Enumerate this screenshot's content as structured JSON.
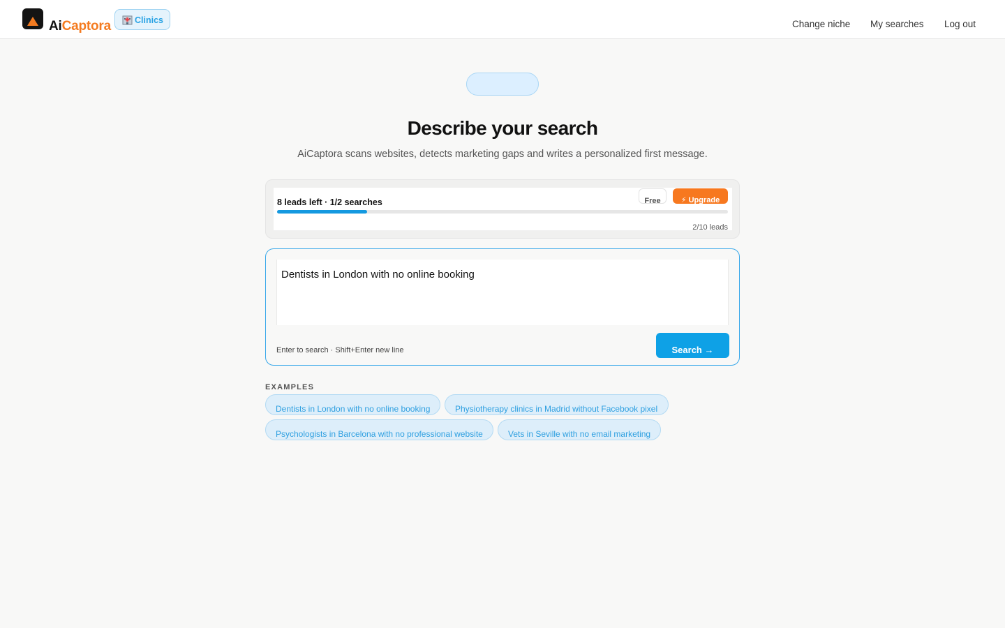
{
  "header": {
    "brand_part1": "Ai",
    "brand_part2": "Captora",
    "niche_badge": "Clinics",
    "nav": [
      "Change niche",
      "My searches",
      "Log out"
    ]
  },
  "hero": {
    "title": "Describe your search",
    "subtitle": "AiCaptora scans websites, detects marketing gaps and writes a personalized first message."
  },
  "usage": {
    "label": "8 leads left · 1/2 searches",
    "plan_badge": "Free",
    "upgrade_label": "⚡ Upgrade",
    "leads_used": 2,
    "leads_total": 10,
    "progress_fraction": 0.2,
    "count_text": "2/10 leads"
  },
  "search": {
    "value": "Dentists in London with no online booking",
    "hint": "Enter to search · Shift+Enter new line",
    "button_label": "Search →"
  },
  "examples": {
    "title": "EXAMPLES",
    "items": [
      "Dentists in London with no online booking",
      "Physiotherapy clinics in Madrid without Facebook pixel",
      "Psychologists in Barcelona with no professional website",
      "Vets in Seville with no email marketing"
    ]
  },
  "colors": {
    "accent_blue": "#0ea1e6",
    "brand_orange": "#f47b20",
    "upgrade_orange": "#f7781f"
  },
  "icons": {
    "logo": "logo-triangle-icon",
    "niche": "hospital-icon"
  }
}
